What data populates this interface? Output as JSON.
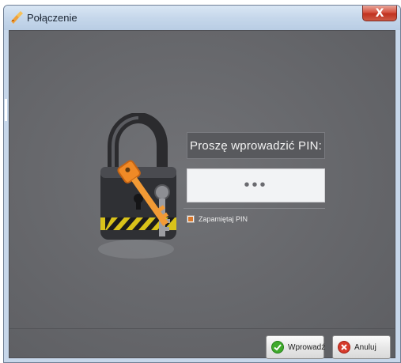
{
  "window": {
    "title": "Połączenie",
    "close_label": "X"
  },
  "pin": {
    "prompt": "Proszę wprowadzić PIN:",
    "value": "•••"
  },
  "remember": {
    "label": "Zapamiętaj PIN",
    "checked": true
  },
  "buttons": {
    "ok": "Wprowadź",
    "cancel": "Anuluj"
  },
  "icons": {
    "app": "key-icon",
    "illustration": "padlock-with-keys-icon",
    "ok": "green-checkmark-icon",
    "cancel": "red-x-icon"
  },
  "colors": {
    "accent_orange": "#e8822a",
    "client_bg": "#66676b",
    "close_red": "#c9402e"
  }
}
